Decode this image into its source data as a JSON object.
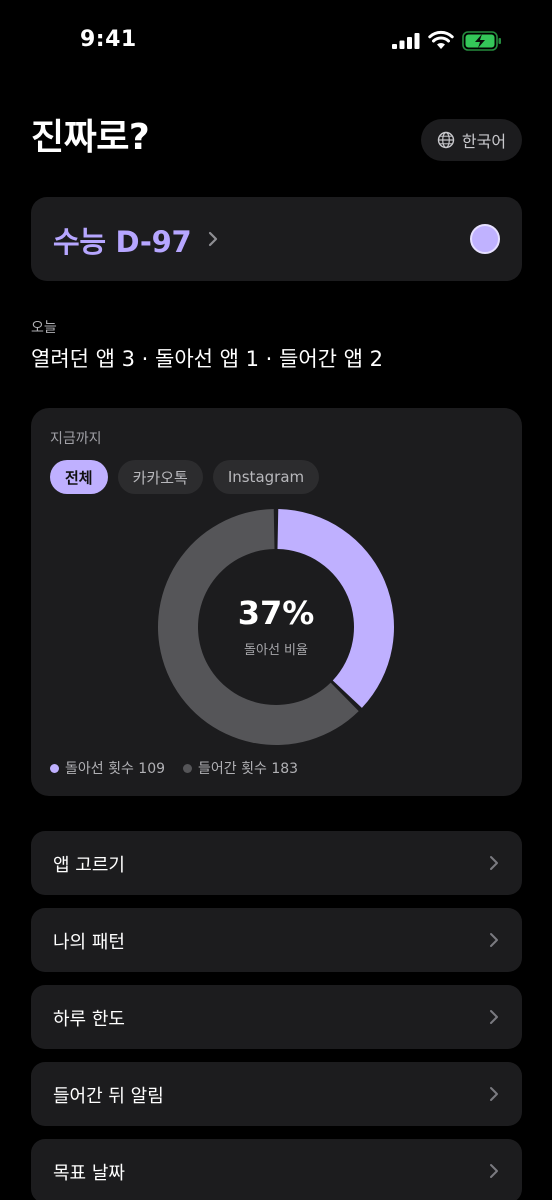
{
  "status_bar": {
    "time": "9:41",
    "icons": [
      "cellular-signal-icon",
      "wifi-icon",
      "battery-charging-icon"
    ],
    "battery_color": "#34c759"
  },
  "header": {
    "title": "진짜로?",
    "language_button": {
      "icon": "globe-icon",
      "label": "한국어"
    }
  },
  "dday": {
    "label": "수능 D-97",
    "chevron": "chevron-right-icon",
    "color_dot": "#c0b2ff",
    "accent": "#b6a6ff"
  },
  "today": {
    "label": "오늘",
    "summary": "열려던 앱 3 · 돌아선 앱 1 · 들어간 앱 2"
  },
  "stats": {
    "label": "지금까지",
    "tabs": [
      {
        "label": "전체",
        "selected": true
      },
      {
        "label": "카카오톡",
        "selected": false
      },
      {
        "label": "Instagram",
        "selected": false
      }
    ],
    "percent_text": "37%",
    "percent_caption": "돌아선 비율",
    "legend": [
      {
        "label": "돌아선 횟수 109",
        "color": "#bfb0ff"
      },
      {
        "label": "들어간 횟수 183",
        "color": "#555558"
      }
    ]
  },
  "chart_data": {
    "type": "pie",
    "categories": [
      "돌아선 횟수",
      "들어간 횟수"
    ],
    "values": [
      109,
      183
    ],
    "colors": [
      "#bfb0ff",
      "#555558"
    ],
    "center_label": "37%"
  },
  "menu": [
    {
      "label": "앱 고르기"
    },
    {
      "label": "나의 패턴"
    },
    {
      "label": "하루 한도"
    },
    {
      "label": "들어간 뒤 알림"
    },
    {
      "label": "목표 날짜"
    }
  ]
}
